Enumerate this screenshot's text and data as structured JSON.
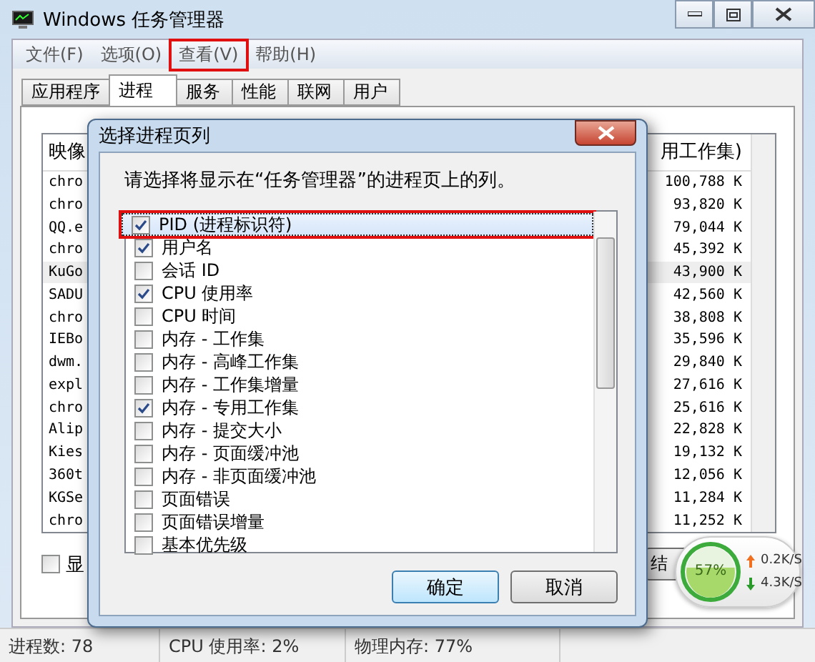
{
  "window": {
    "title": "Windows 任务管理器"
  },
  "menu": [
    {
      "label": "文件(F)",
      "highlighted": false
    },
    {
      "label": "选项(O)",
      "highlighted": false
    },
    {
      "label": "查看(V)",
      "highlighted": true
    },
    {
      "label": "帮助(H)",
      "highlighted": false
    }
  ],
  "tabs": [
    {
      "label": "应用程序",
      "selected": false
    },
    {
      "label": "进程",
      "selected": true
    },
    {
      "label": "服务",
      "selected": false
    },
    {
      "label": "性能",
      "selected": false
    },
    {
      "label": "联网",
      "selected": false
    },
    {
      "label": "用户",
      "selected": false
    }
  ],
  "process_table": {
    "columns": [
      "映像",
      "用工作集)"
    ],
    "rows": [
      {
        "name": "chro",
        "memory": "100,788 K",
        "selected": false
      },
      {
        "name": "chro",
        "memory": "93,820 K",
        "selected": false
      },
      {
        "name": "QQ.e",
        "memory": "79,044 K",
        "selected": false
      },
      {
        "name": "chro",
        "memory": "45,392 K",
        "selected": false
      },
      {
        "name": "KuGo",
        "memory": "43,900 K",
        "selected": true
      },
      {
        "name": "SADU",
        "memory": "42,560 K",
        "selected": false
      },
      {
        "name": "chro",
        "memory": "38,808 K",
        "selected": false
      },
      {
        "name": "IEBo",
        "memory": "35,596 K",
        "selected": false
      },
      {
        "name": "dwm.",
        "memory": "29,840 K",
        "selected": false
      },
      {
        "name": "expl",
        "memory": "27,616 K",
        "selected": false
      },
      {
        "name": "chro",
        "memory": "25,616 K",
        "selected": false
      },
      {
        "name": "Alip",
        "memory": "22,828 K",
        "selected": false
      },
      {
        "name": "Kies",
        "memory": "19,132 K",
        "selected": false
      },
      {
        "name": "360t",
        "memory": "12,056 K",
        "selected": false
      },
      {
        "name": "KGSe",
        "memory": "11,284 K",
        "selected": false
      },
      {
        "name": "chro",
        "memory": "11,252 K",
        "selected": false
      }
    ]
  },
  "show_all_checkbox": {
    "label": "显",
    "checked": false
  },
  "end_button": {
    "label": "结"
  },
  "status_bar": [
    "进程数: 78",
    "CPU 使用率: 2%",
    "物理内存: 77%"
  ],
  "dialog": {
    "title": "选择进程页列",
    "instruction": "请选择将显示在“任务管理器”的进程页上的列。",
    "columns": [
      {
        "label": "PID (进程标识符)",
        "checked": true,
        "selected": true
      },
      {
        "label": "用户名",
        "checked": true,
        "selected": false
      },
      {
        "label": "会话 ID",
        "checked": false,
        "selected": false
      },
      {
        "label": "CPU 使用率",
        "checked": true,
        "selected": false
      },
      {
        "label": "CPU 时间",
        "checked": false,
        "selected": false
      },
      {
        "label": "内存 - 工作集",
        "checked": false,
        "selected": false
      },
      {
        "label": "内存 - 高峰工作集",
        "checked": false,
        "selected": false
      },
      {
        "label": "内存 - 工作集增量",
        "checked": false,
        "selected": false
      },
      {
        "label": "内存 - 专用工作集",
        "checked": true,
        "selected": false
      },
      {
        "label": "内存 - 提交大小",
        "checked": false,
        "selected": false
      },
      {
        "label": "内存 - 页面缓冲池",
        "checked": false,
        "selected": false
      },
      {
        "label": "内存 - 非页面缓冲池",
        "checked": false,
        "selected": false
      },
      {
        "label": "页面错误",
        "checked": false,
        "selected": false
      },
      {
        "label": "页面错误增量",
        "checked": false,
        "selected": false
      },
      {
        "label": "基本优先级",
        "checked": false,
        "selected": false
      }
    ],
    "buttons": [
      "确定",
      "取消"
    ]
  },
  "net_widget": {
    "cpu": "57%",
    "level": 0.57,
    "upload": "0.2K/S",
    "download": "4.3K/S"
  }
}
